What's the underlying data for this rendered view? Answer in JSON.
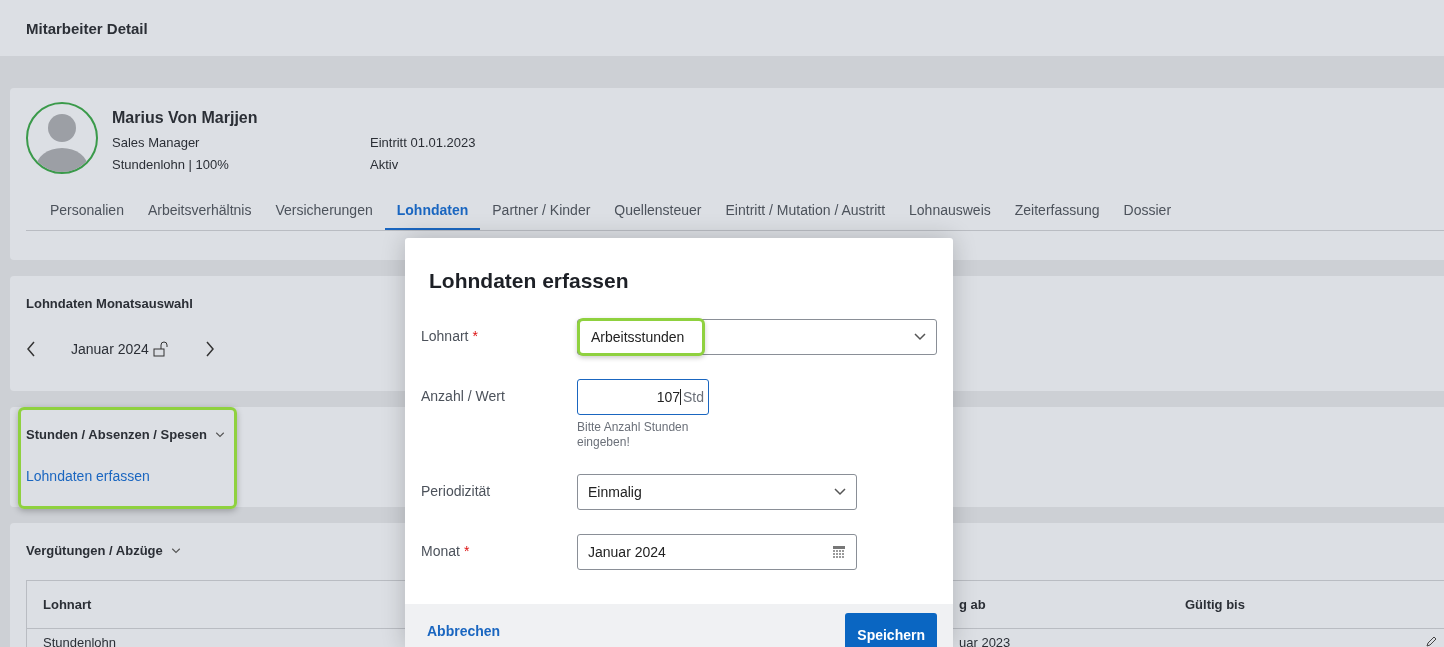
{
  "page_title": "Mitarbeiter Detail",
  "employee": {
    "name": "Marius Von Marjjen",
    "position": "Sales Manager",
    "wage": "Stundenlohn | 100%",
    "entry": "Eintritt 01.01.2023",
    "status": "Aktiv"
  },
  "tabs": [
    {
      "label": "Personalien",
      "selected": false
    },
    {
      "label": "Arbeitsverhältnis",
      "selected": false
    },
    {
      "label": "Versicherungen",
      "selected": false
    },
    {
      "label": "Lohndaten",
      "selected": true
    },
    {
      "label": "Partner / Kinder",
      "selected": false
    },
    {
      "label": "Quellensteuer",
      "selected": false
    },
    {
      "label": "Eintritt / Mutation / Austritt",
      "selected": false
    },
    {
      "label": "Lohnausweis",
      "selected": false
    },
    {
      "label": "Zeiterfassung",
      "selected": false
    },
    {
      "label": "Dossier",
      "selected": false
    }
  ],
  "month_selector": {
    "title": "Lohndaten Monatsauswahl",
    "month": "Januar 2024",
    "locked": false
  },
  "hours_section": {
    "title": "Stunden / Absenzen / Spesen",
    "link": "Lohndaten erfassen",
    "highlighted": true
  },
  "compensation_section": {
    "title": "Vergütungen / Abzüge",
    "table": {
      "columns": [
        "Lohnart",
        "g ab",
        "Gültig bis"
      ],
      "rows": [
        [
          "Stundenlohn",
          "uar 2023",
          ""
        ]
      ]
    }
  },
  "dialog": {
    "title": "Lohndaten erfassen",
    "fields": [
      {
        "kind": "select",
        "label": "Lohnart",
        "required_mark": "*",
        "value": "Arbeitsstunden",
        "highlighted": true
      },
      {
        "kind": "number",
        "label": "Anzahl / Wert",
        "value": "107",
        "unit": "Std",
        "hint": "Bitte Anzahl Stunden eingeben!",
        "focused": true
      },
      {
        "kind": "select",
        "label": "Periodizität",
        "value": "Einmalig"
      },
      {
        "kind": "date",
        "label": "Monat",
        "required_mark": "*",
        "value": "Januar 2024"
      }
    ],
    "cancel": "Abbrechen",
    "save": "Speichern"
  }
}
